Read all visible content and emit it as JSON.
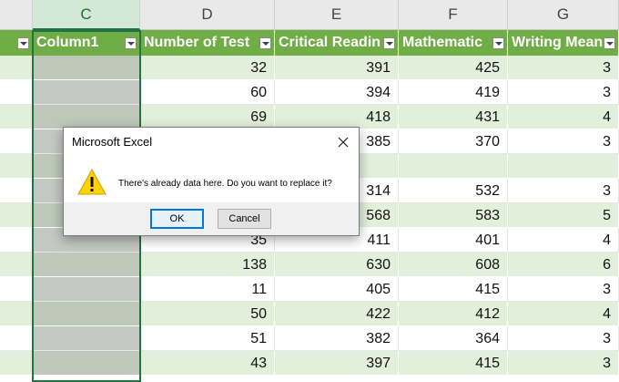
{
  "columns": {
    "C": "C",
    "D": "D",
    "E": "E",
    "F": "F",
    "G": "G"
  },
  "table_headers": {
    "col_c": "Column1",
    "col_d": "Number of Test",
    "col_e": "Critical Readin",
    "col_f": "Mathematic",
    "col_g": "Writing Mean"
  },
  "rows": [
    {
      "d": "32",
      "e": "391",
      "f": "425",
      "g": "3"
    },
    {
      "d": "60",
      "e": "394",
      "f": "419",
      "g": "3"
    },
    {
      "d": "69",
      "e": "418",
      "f": "431",
      "g": "4"
    },
    {
      "d": "",
      "e": "385",
      "f": "370",
      "g": "3"
    },
    {
      "d": "",
      "e": "",
      "f": "",
      "g": ""
    },
    {
      "d": "",
      "e": "314",
      "f": "532",
      "g": "3"
    },
    {
      "d": "",
      "e": "568",
      "f": "583",
      "g": "5"
    },
    {
      "d": "35",
      "e": "411",
      "f": "401",
      "g": "4"
    },
    {
      "d": "138",
      "e": "630",
      "f": "608",
      "g": "6"
    },
    {
      "d": "11",
      "e": "405",
      "f": "415",
      "g": "3"
    },
    {
      "d": "50",
      "e": "422",
      "f": "412",
      "g": "4"
    },
    {
      "d": "51",
      "e": "382",
      "f": "364",
      "g": "3"
    },
    {
      "d": "43",
      "e": "397",
      "f": "415",
      "g": "3"
    }
  ],
  "dialog": {
    "title": "Microsoft Excel",
    "message": "There's already data here. Do you want to replace it?",
    "ok_label": "OK",
    "cancel_label": "Cancel",
    "icon": "warning-icon",
    "close_icon": "close-icon"
  },
  "colors": {
    "table_header": "#70ad47",
    "band": "#e2efda",
    "selection": "#217346"
  }
}
